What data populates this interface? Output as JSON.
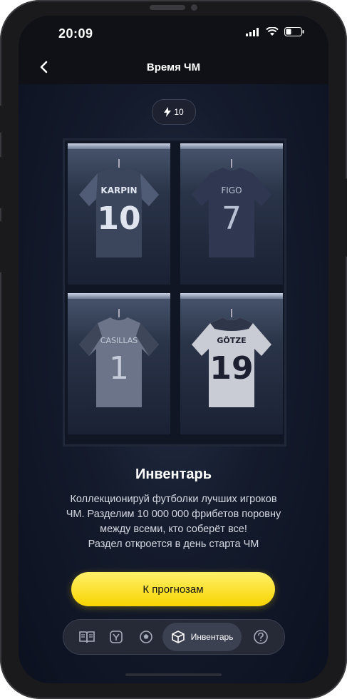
{
  "status_bar": {
    "time": "20:09"
  },
  "header": {
    "title": "Время ЧМ"
  },
  "energy": {
    "count": "10"
  },
  "jerseys": [
    {
      "name": "KARPIN",
      "number": "10"
    },
    {
      "name": "FIGO",
      "number": "7"
    },
    {
      "name": "CASILLAS",
      "number": "1"
    },
    {
      "name": "GÖTZE",
      "number": "19"
    }
  ],
  "inventory": {
    "title": "Инвентарь",
    "line1": "Коллекционируй футболки лучших игроков",
    "line2": "ЧМ. Разделим 10 000 000 фрибетов поровну",
    "line3": "между всеми, кто соберёт все!",
    "line4": "Раздел откроется в день старта ЧМ"
  },
  "cta": {
    "label": "К прогнозам"
  },
  "tabs": {
    "active_label": "Инвентарь"
  }
}
